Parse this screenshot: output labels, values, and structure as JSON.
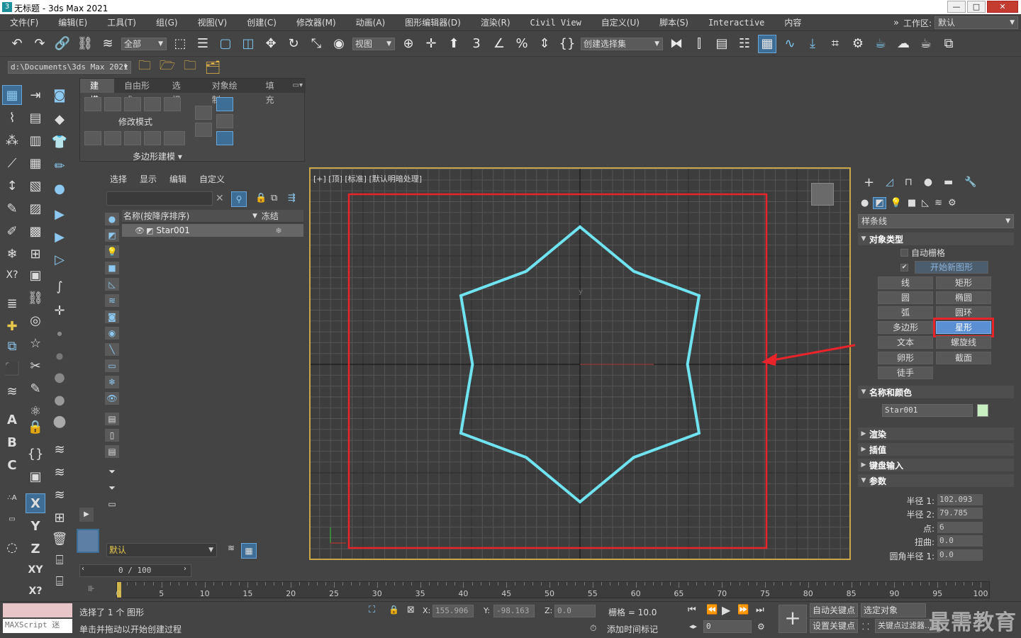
{
  "window": {
    "title": "无标题 - 3ds Max 2021",
    "minimize": "—",
    "maximize": "□",
    "close": "✕"
  },
  "menu": [
    "文件(F)",
    "编辑(E)",
    "工具(T)",
    "组(G)",
    "视图(V)",
    "创建(C)",
    "修改器(M)",
    "动画(A)",
    "图形编辑器(D)",
    "渲染(R)",
    "Civil View",
    "自定义(U)",
    "脚本(S)",
    "Interactive",
    "内容"
  ],
  "workspace": {
    "label": "工作区:",
    "value": "默认"
  },
  "toolbar": {
    "filter_select": "全部",
    "ref_coord_select": "视图",
    "named_selection_set": "创建选择集"
  },
  "toolbar2": {
    "project_path": "d:\\Documents\\3ds Max 2021"
  },
  "ribbon": {
    "tabs": [
      "建模",
      "自由形式",
      "选择",
      "对象绘制",
      "填充"
    ],
    "mode_label": "修改模式",
    "poly_label": "多边形建模 ▾"
  },
  "scene_explorer": {
    "menu": [
      "选择",
      "显示",
      "编辑",
      "自定义"
    ],
    "col_name": "名称(按降序排序)",
    "col_freeze": "冻结",
    "object": "Star001",
    "layer": "默认"
  },
  "viewport": {
    "label": "[+] [顶] [标准] [默认明暗处理]",
    "axis_y": "y",
    "star": {
      "radius1": 102.093,
      "radius2": 79.785,
      "points": 6
    }
  },
  "command_panel": {
    "category": "样条线",
    "rollouts": {
      "object_type": "对象类型",
      "name_color": "名称和颜色",
      "render": "渲染",
      "interp": "插值",
      "keyboard": "键盘输入",
      "params": "参数"
    },
    "autogrid": "自动栅格",
    "start_new_shape": "开始新图形",
    "buttons": [
      "线",
      "矩形",
      "圆",
      "椭圆",
      "弧",
      "圆环",
      "多边形",
      "星形",
      "文本",
      "螺旋线",
      "卵形",
      "截面",
      "徒手"
    ],
    "selected_button": "星形",
    "object_name": "Star001",
    "object_color": "#c8efc0",
    "params": [
      {
        "label": "半径 1:",
        "value": "102.093"
      },
      {
        "label": "半径 2:",
        "value": "79.785"
      },
      {
        "label": "点:",
        "value": "6"
      },
      {
        "label": "扭曲:",
        "value": "0.0"
      },
      {
        "label": "圆角半径 1:",
        "value": "0.0"
      }
    ]
  },
  "timeline": {
    "slider": "0 / 100",
    "ticks": [
      "0",
      "5",
      "10",
      "15",
      "20",
      "25",
      "30",
      "35",
      "40",
      "45",
      "50",
      "55",
      "60",
      "65",
      "70",
      "75",
      "80",
      "85",
      "90",
      "95",
      "100"
    ]
  },
  "status": {
    "maxscript": "MAXScript 迷",
    "selected": "选择了 1 个 图形",
    "prompt": "单击并拖动以开始创建过程",
    "x_label": "X:",
    "x": "155.906",
    "y_label": "Y:",
    "y": "-98.163",
    "z_label": "Z:",
    "z": "0.0",
    "grid": "栅格 = 10.0",
    "add_time_tag": "添加时间标记",
    "auto_key": "自动关键点",
    "set_key": "设置关键点",
    "selected_obj": "选定对象",
    "key_filter": "关键点过滤器...",
    "frame": "0",
    "watermark": "最需教育"
  },
  "colors": {
    "accent": "#5b8fd4",
    "highlight_red": "#e8242a",
    "star_cyan": "#6fe3f0",
    "viewport_border": "#c9a646"
  }
}
